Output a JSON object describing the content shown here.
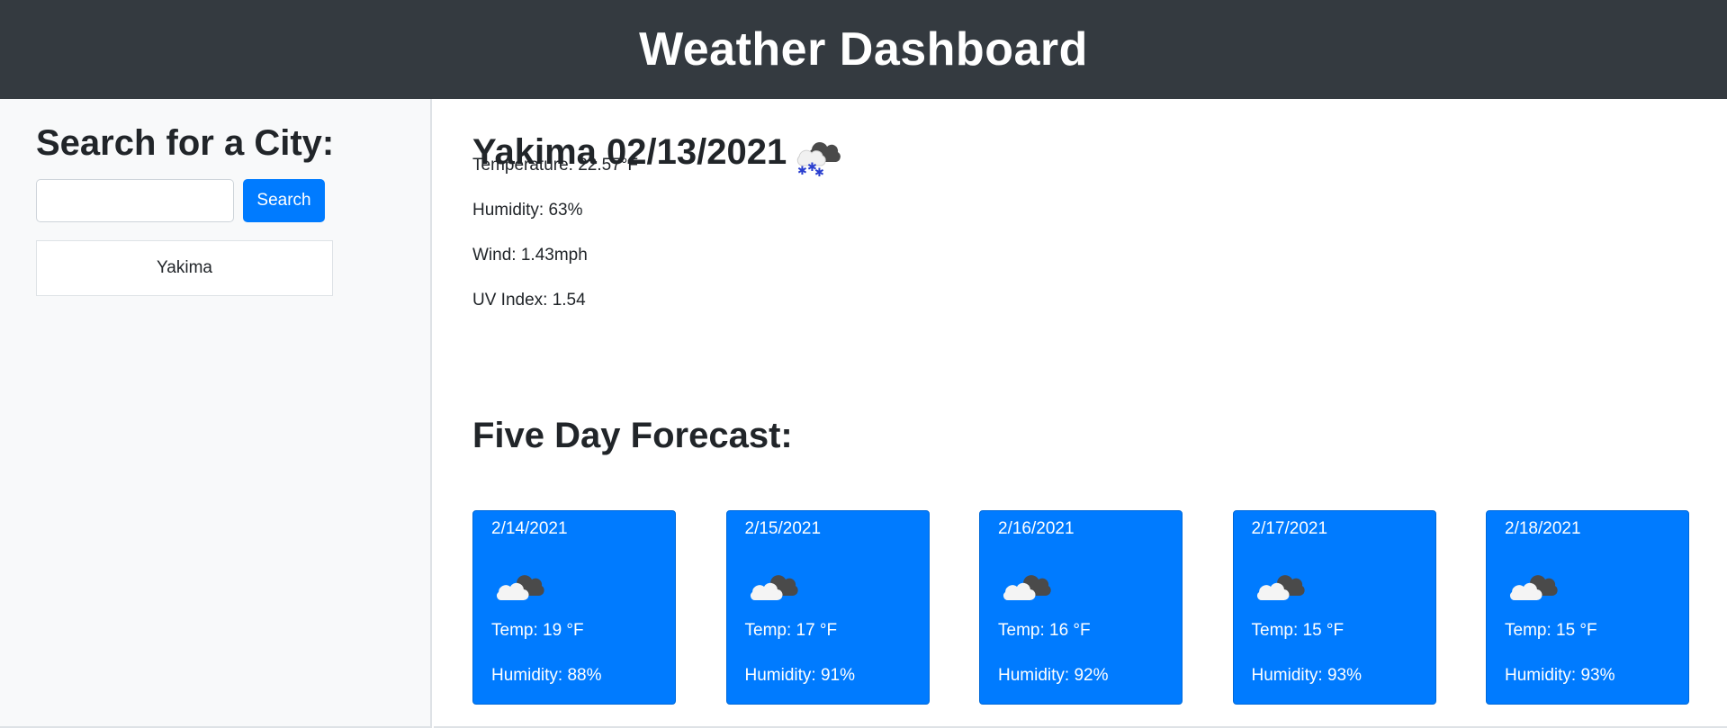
{
  "header": {
    "title": "Weather Dashboard"
  },
  "sidebar": {
    "heading": "Search for a City:",
    "search": {
      "value": "",
      "placeholder": "",
      "button_label": "Search"
    },
    "history": [
      {
        "label": "Yakima"
      }
    ]
  },
  "current": {
    "title": "Yakima 02/13/2021",
    "icon": "snow-cloud-icon",
    "temperature": "Temperature: 22.57°F",
    "humidity": "Humidity: 63%",
    "wind": "Wind: 1.43mph",
    "uv_index": "UV Index: 1.54"
  },
  "forecast": {
    "title": "Five Day Forecast:",
    "days": [
      {
        "date": "2/14/2021",
        "icon": "cloud-icon",
        "temp": "Temp: 19 °F",
        "humidity": "Humidity: 88%"
      },
      {
        "date": "2/15/2021",
        "icon": "cloud-icon",
        "temp": "Temp: 17 °F",
        "humidity": "Humidity: 91%"
      },
      {
        "date": "2/16/2021",
        "icon": "cloud-icon",
        "temp": "Temp: 16 °F",
        "humidity": "Humidity: 92%"
      },
      {
        "date": "2/17/2021",
        "icon": "cloud-icon",
        "temp": "Temp: 15 °F",
        "humidity": "Humidity: 93%"
      },
      {
        "date": "2/18/2021",
        "icon": "cloud-icon",
        "temp": "Temp: 15 °F",
        "humidity": "Humidity: 93%"
      }
    ]
  },
  "colors": {
    "header_bg": "#343a40",
    "sidebar_bg": "#f8f9fa",
    "accent": "#007bff"
  }
}
